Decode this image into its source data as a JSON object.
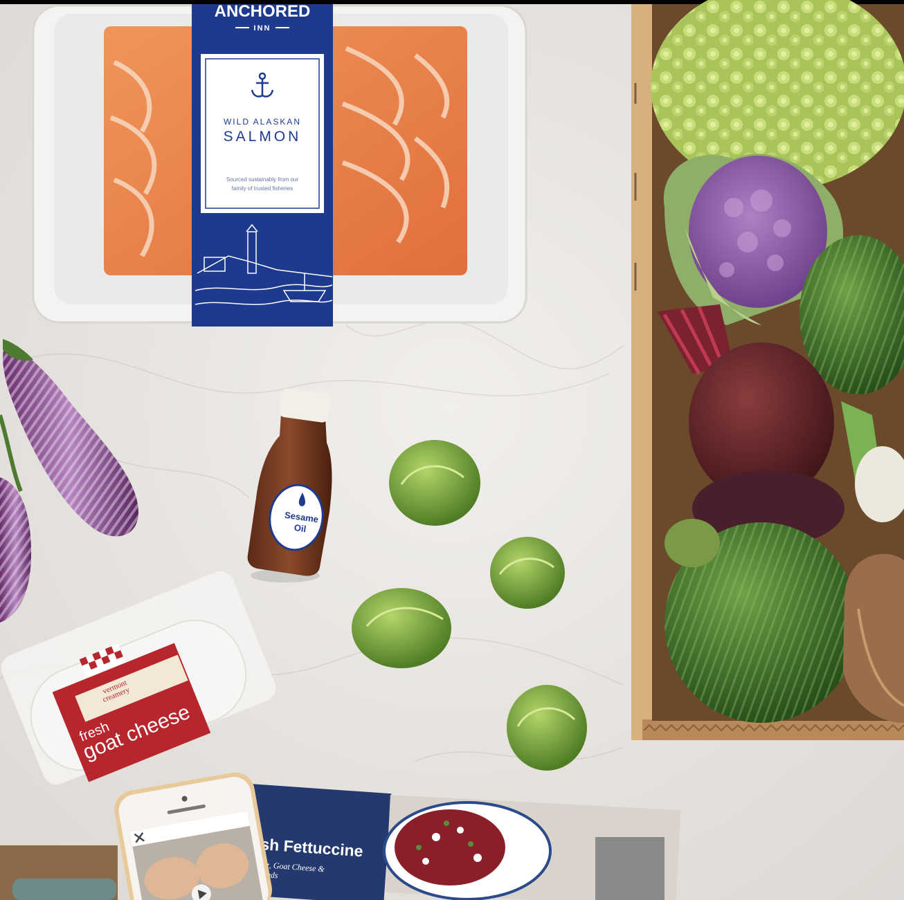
{
  "salmon_label": {
    "brand_top": "ANCHORED",
    "brand_sub": "INN",
    "kind_line1": "WILD ALASKAN",
    "kind_line2": "SALMON",
    "desc_line1": "Sourced sustainably from our",
    "desc_line2": "family of trusted fisheries"
  },
  "oil_label": {
    "line1": "Sesame",
    "line2": "Oil"
  },
  "cheese_label": {
    "brand1": "vermont",
    "brand2": "creamery",
    "word1": "fresh",
    "word2": "goat cheese"
  },
  "recipe_card": {
    "title": "sh Fettuccine",
    "sub1": "et, Goat Cheese &",
    "sub2": "eeds"
  },
  "colors": {
    "marble": "#e9e6e2",
    "salmon": "#e8814a",
    "label_blue": "#1d3a8f",
    "cardboard": "#c49663",
    "cauliflower": "#8e5ba6",
    "beet": "#6e2a2e",
    "zucchini": "#3f7a33",
    "romanesco": "#b6cf6a",
    "brussels": "#7fa53c",
    "cheese_red": "#b8262d"
  }
}
